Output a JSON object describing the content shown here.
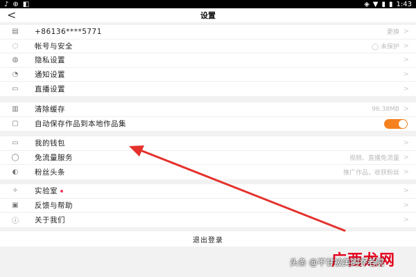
{
  "statusbar": {
    "left_icons": [
      "♪",
      "⊕",
      "◧"
    ],
    "time": "1:43",
    "right_icons": [
      "◈",
      "▼",
      "▮",
      "▮"
    ]
  },
  "header": {
    "back": "<",
    "title": "设置"
  },
  "group1": [
    {
      "icon": "▤",
      "label": "+86136****5771",
      "value": "更换"
    },
    {
      "icon": "◌",
      "label": "帐号与安全",
      "value": "◯ 未保护"
    },
    {
      "icon": "◍",
      "label": "隐私设置",
      "value": ""
    },
    {
      "icon": "◔",
      "label": "通知设置",
      "value": ""
    },
    {
      "icon": "▭",
      "label": "直播设置",
      "value": ""
    }
  ],
  "group2": [
    {
      "icon": "▥",
      "label": "清除缓存",
      "value": "96.38MB"
    },
    {
      "icon": "▢",
      "label": "自动保存作品到本地作品集",
      "toggle_on": true
    }
  ],
  "group3": [
    {
      "icon": "▭",
      "label": "我的钱包",
      "value": ""
    },
    {
      "icon": "◯",
      "label": "免流量服务",
      "value": "视频、直播免流量"
    },
    {
      "icon": "◐",
      "label": "粉丝头条",
      "value": "推广作品，收获粉丝"
    }
  ],
  "group4": [
    {
      "icon": "✧",
      "label": "实验室",
      "dot": true,
      "value": ""
    },
    {
      "icon": "▣",
      "label": "反馈与帮助",
      "value": ""
    },
    {
      "icon": "ⓘ",
      "label": "关于我们",
      "value": ""
    }
  ],
  "logout_label": "退出登录",
  "chevron": ">",
  "watermark": {
    "site": "广西龙网",
    "author": "头条 @不甘被美的乔老院"
  },
  "colors": {
    "accent": "#f5811f",
    "arrow": "#e4312b",
    "dot": "#ff3b5c"
  }
}
